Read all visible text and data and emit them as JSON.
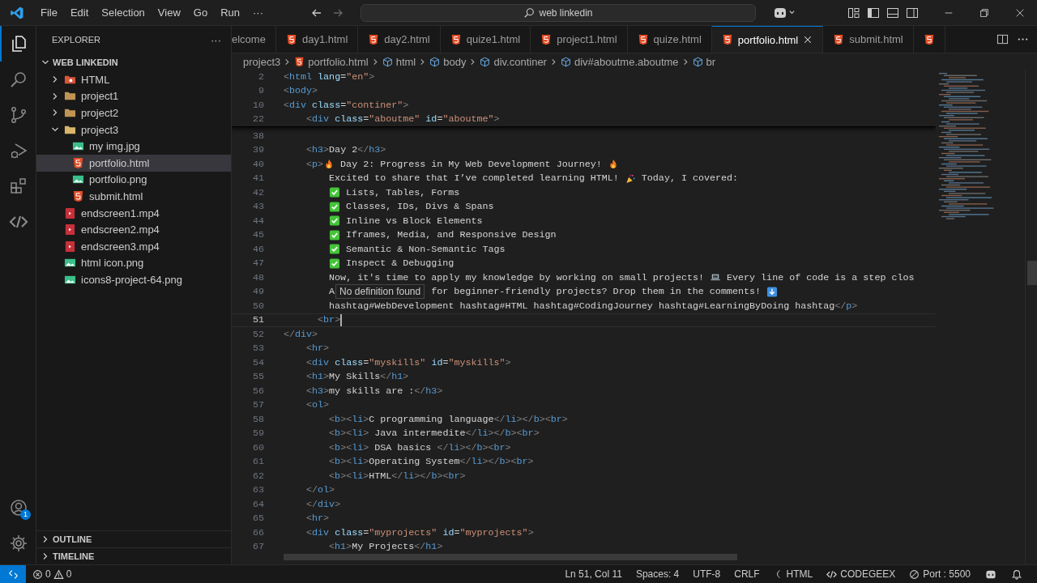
{
  "title_bar": {
    "menus": [
      "File",
      "Edit",
      "Selection",
      "View",
      "Go",
      "Run",
      "···"
    ],
    "search": {
      "value": "web linkedin"
    }
  },
  "activity_bar": {
    "items": [
      {
        "kind": "explorer",
        "selected": true
      },
      {
        "kind": "search",
        "selected": false
      },
      {
        "kind": "source-control",
        "selected": false
      },
      {
        "kind": "debug",
        "selected": false
      },
      {
        "kind": "extensions",
        "selected": false
      },
      {
        "kind": "code",
        "selected": false
      }
    ],
    "accounts_badge": "1"
  },
  "sidebar": {
    "title": "EXPLORER",
    "menu": "···",
    "section": {
      "title": "WEB LINKEDIN",
      "expanded": true
    },
    "items": [
      {
        "label": "HTML",
        "kind": "html-folder",
        "expanded": false,
        "selected": false
      },
      {
        "label": "project1",
        "kind": "folder",
        "expanded": false,
        "selected": false
      },
      {
        "label": "project2",
        "kind": "folder",
        "expanded": false,
        "selected": false
      },
      {
        "label": "project3",
        "kind": "folder",
        "expanded": true,
        "selected": false,
        "children": [
          {
            "label": "my img.jpg",
            "kind": "image",
            "selected": false
          },
          {
            "label": "portfolio.html",
            "kind": "html",
            "selected": true
          },
          {
            "label": "portfolio.png",
            "kind": "image",
            "selected": false
          },
          {
            "label": "submit.html",
            "kind": "html",
            "selected": false
          }
        ]
      },
      {
        "label": "endscreen1.mp4",
        "kind": "video",
        "selected": false
      },
      {
        "label": "endscreen2.mp4",
        "kind": "video",
        "selected": false
      },
      {
        "label": "endscreen3.mp4",
        "kind": "video",
        "selected": false
      },
      {
        "label": "html icon.png",
        "kind": "image",
        "selected": false
      },
      {
        "label": "icons8-project-64.png",
        "kind": "image",
        "selected": false
      }
    ],
    "panels": [
      {
        "title": "OUTLINE",
        "expanded": false
      },
      {
        "title": "TIMELINE",
        "expanded": false
      }
    ]
  },
  "tabs": [
    {
      "label": "elcome",
      "kind": "welcome",
      "selected": false
    },
    {
      "label": "day1.html",
      "kind": "html",
      "selected": false
    },
    {
      "label": "day2.html",
      "kind": "html",
      "selected": false
    },
    {
      "label": "quize1.html",
      "kind": "html",
      "selected": false
    },
    {
      "label": "project1.html",
      "kind": "html",
      "selected": false
    },
    {
      "label": "quize.html",
      "kind": "html",
      "selected": false
    },
    {
      "label": "portfolio.html",
      "kind": "html",
      "selected": true
    },
    {
      "label": "submit.html",
      "kind": "html",
      "selected": false
    },
    {
      "kind": "html",
      "selected": false
    }
  ],
  "breadcrumbs": [
    {
      "label": "project3",
      "kind": "folder"
    },
    {
      "label": "portfolio.html",
      "kind": "html"
    },
    {
      "label": "html",
      "kind": "element"
    },
    {
      "label": "body",
      "kind": "element"
    },
    {
      "label": "div.continer",
      "kind": "element"
    },
    {
      "label": "div#aboutme.aboutme",
      "kind": "element"
    },
    {
      "label": "br",
      "kind": "element"
    }
  ],
  "editor": {
    "sticky_lines": [
      {
        "number": "2",
        "parts": [
          {
            "kind": "code",
            "text": "<html lang=\"en\">"
          }
        ]
      },
      {
        "number": "9",
        "parts": [
          {
            "kind": "code",
            "text": "<body>"
          }
        ]
      },
      {
        "number": "10",
        "parts": [
          {
            "kind": "code",
            "text": "<div class=\"continer\">"
          }
        ],
        "children": [
          {
            "number": "22",
            "parts": [
              {
                "kind": "code",
                "text": "<div class=\"aboutme\" id=\"aboutme\">"
              }
            ]
          }
        ]
      }
    ],
    "lines": [
      {
        "children": [
          {
            "number": "38",
            "current": false
          },
          {
            "number": "39",
            "current": false,
            "parts": [
              {
                "kind": "code",
                "text": "<h3>Day 2</h3>"
              }
            ]
          },
          {
            "number": "40",
            "current": false,
            "parts": [
              {
                "kind": "code",
                "text": "<p>"
              },
              {
                "kind": "fire"
              },
              {
                "kind": "code",
                "text": " Day 2: Progress in My Web Development Journey! "
              },
              {
                "kind": "fire"
              }
            ],
            "children": [
              {
                "number": "41",
                "current": false,
                "parts": [
                  {
                    "kind": "code",
                    "text": "Excited to share that I’ve completed learning HTML! "
                  },
                  {
                    "kind": "party"
                  },
                  {
                    "kind": "code",
                    "text": " Today, I covered:"
                  }
                ]
              },
              {
                "number": "42",
                "current": false,
                "parts": [
                  {
                    "kind": "check"
                  },
                  {
                    "kind": "code",
                    "text": " Lists, Tables, Forms"
                  }
                ]
              },
              {
                "number": "43",
                "current": false,
                "parts": [
                  {
                    "kind": "check"
                  },
                  {
                    "kind": "code",
                    "text": " Classes, IDs, Divs & Spans"
                  }
                ]
              },
              {
                "number": "44",
                "current": false,
                "parts": [
                  {
                    "kind": "check"
                  },
                  {
                    "kind": "code",
                    "text": " Inline vs Block Elements"
                  }
                ]
              },
              {
                "number": "45",
                "current": false,
                "parts": [
                  {
                    "kind": "check"
                  },
                  {
                    "kind": "code",
                    "text": " Iframes, Media, and Responsive Design"
                  }
                ]
              },
              {
                "number": "46",
                "current": false,
                "parts": [
                  {
                    "kind": "check"
                  },
                  {
                    "kind": "code",
                    "text": " Semantic & Non-Semantic Tags"
                  }
                ]
              },
              {
                "number": "47",
                "current": false,
                "parts": [
                  {
                    "kind": "check"
                  },
                  {
                    "kind": "code",
                    "text": " Inspect & Debugging"
                  }
                ]
              },
              {
                "number": "48",
                "current": false,
                "parts": [
                  {
                    "kind": "code",
                    "text": "Now, it's time to apply my knowledge by working on small projects! "
                  },
                  {
                    "kind": "laptop"
                  },
                  {
                    "kind": "code",
                    "text": " Every line of code is a step clos"
                  }
                ]
              },
              {
                "number": "49",
                "current": false,
                "parts": [
                  {
                    "kind": "code",
                    "text": "A"
                  },
                  {
                    "kind": "tooltip",
                    "text": "No definition found"
                  },
                  {
                    "kind": "code",
                    "text": "for beginner-friendly projects? Drop them in the comments! "
                  },
                  {
                    "kind": "down-arrow"
                  }
                ]
              },
              {
                "number": "50",
                "current": false,
                "parts": [
                  {
                    "kind": "code",
                    "text": "hashtag#WebDevelopment hashtag#HTML hashtag#CodingJourney hashtag#LearningByDoing hashtag</p>"
                  }
                ]
              }
            ]
          },
          {
            "number": "51",
            "current": true,
            "parts": [
              {
                "kind": "code",
                "text": "  <br>"
              }
            ]
          }
        ]
      },
      {
        "number": "52",
        "current": false,
        "parts": [
          {
            "kind": "code",
            "text": "</div>"
          }
        ]
      },
      {
        "children": [
          {
            "number": "53",
            "current": false,
            "parts": [
              {
                "kind": "code",
                "text": "<hr>"
              }
            ]
          },
          {
            "number": "54",
            "current": false,
            "parts": [
              {
                "kind": "code",
                "text": "<div class=\"myskills\" id=\"myskills\">"
              }
            ]
          },
          {
            "number": "55",
            "current": false,
            "parts": [
              {
                "kind": "code",
                "text": "<h1>My Skills</h1>"
              }
            ]
          },
          {
            "number": "56",
            "current": false,
            "parts": [
              {
                "kind": "code",
                "text": "<h3>my skills are :</h3>"
              }
            ]
          },
          {
            "number": "57",
            "current": false,
            "parts": [
              {
                "kind": "code",
                "text": "<ol>"
              }
            ],
            "children": [
              {
                "number": "58",
                "current": false,
                "parts": [
                  {
                    "kind": "code",
                    "text": "<b><li>C programming language</li></b><br>"
                  }
                ]
              },
              {
                "number": "59",
                "current": false,
                "parts": [
                  {
                    "kind": "code",
                    "text": "<b><li> Java intermedite</li></b><br>"
                  }
                ]
              },
              {
                "number": "60",
                "current": false,
                "parts": [
                  {
                    "kind": "code",
                    "text": "<b><li> DSA basics </li></b><br>"
                  }
                ]
              },
              {
                "number": "61",
                "current": false,
                "parts": [
                  {
                    "kind": "code",
                    "text": "<b><li>Operating System</li></b><br>"
                  }
                ]
              },
              {
                "number": "62",
                "current": false,
                "parts": [
                  {
                    "kind": "code",
                    "text": "<b><li>HTML</li></b><br>"
                  }
                ]
              }
            ]
          },
          {
            "number": "63",
            "current": false,
            "parts": [
              {
                "kind": "code",
                "text": "</ol>"
              }
            ]
          },
          {
            "number": "64",
            "current": false,
            "parts": [
              {
                "kind": "code",
                "text": "</div>"
              }
            ]
          },
          {
            "number": "65",
            "current": false,
            "parts": [
              {
                "kind": "code",
                "text": "<hr>"
              }
            ]
          },
          {
            "number": "66",
            "current": false,
            "parts": [
              {
                "kind": "code",
                "text": "<div class=\"myprojects\" id=\"myprojects\">"
              }
            ],
            "children": [
              {
                "number": "67",
                "current": false,
                "parts": [
                  {
                    "kind": "code",
                    "text": "<h1>My Projects</h1>"
                  }
                ]
              }
            ]
          }
        ]
      }
    ]
  },
  "status_bar": {
    "errors": "0",
    "warnings": "0",
    "items": [
      {
        "kind": "text",
        "label": "Ln 51, Col 11"
      },
      {
        "kind": "text",
        "label": "Spaces: 4"
      },
      {
        "kind": "text",
        "label": "UTF-8"
      },
      {
        "kind": "text",
        "label": "CRLF"
      },
      {
        "kind": "language",
        "label": "HTML"
      },
      {
        "kind": "codegeex",
        "label": "CODEGEEX"
      },
      {
        "kind": "port",
        "label": "Port : 5500"
      },
      {
        "kind": "copilot"
      },
      {
        "kind": "bell"
      }
    ]
  }
}
